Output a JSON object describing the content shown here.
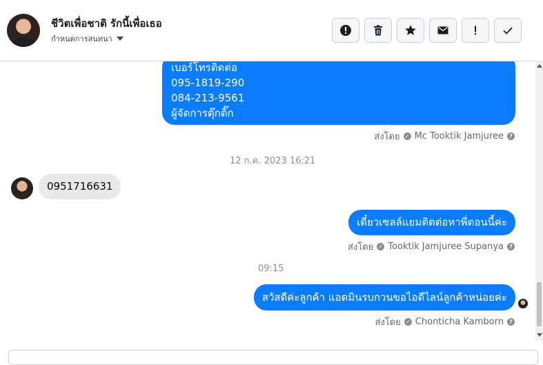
{
  "header": {
    "contact_name": "ชีวิตเพื่อชาติ รักนี้เพื่อเธอ",
    "conversation_settings_label": "กำหนดการสนทนา",
    "toolbar": [
      {
        "name": "report-icon"
      },
      {
        "name": "trash-icon"
      },
      {
        "name": "star-icon"
      },
      {
        "name": "mail-icon"
      },
      {
        "name": "exclamation-icon"
      },
      {
        "name": "check-icon"
      }
    ]
  },
  "messages": {
    "m1": {
      "lines": [
        "เบอร์โทรติดต่อ",
        "095-1819-290",
        "084-213-9561",
        "ผู้จัดการตุ๊กติ๊ก"
      ],
      "sent_by_label": "ส่งโดย",
      "sender": "Mc Tooktik Jamjuree"
    },
    "timestamp1": "12 ก.ค. 2023 16:21",
    "m2": {
      "text": "0951716631"
    },
    "m3": {
      "text": "เดี๋ยวเซลล์แยมติดต่อหาพี่ตอนนี้ค่ะ",
      "sent_by_label": "ส่งโดย",
      "sender": "Tooktik Jamjuree Supanya"
    },
    "timestamp2": "09:15",
    "m4": {
      "text": "สวัสดีค่ะลูกค้า แอดมินรบกวนขอไอดีไลน์ลูกค้าหน่อยค่ะ",
      "sent_by_label": "ส่งโดย",
      "sender": "Chonticha Kamborn"
    }
  },
  "colors": {
    "outgoing_bubble": "#0a7cff",
    "incoming_bubble": "#e9e9eb"
  }
}
